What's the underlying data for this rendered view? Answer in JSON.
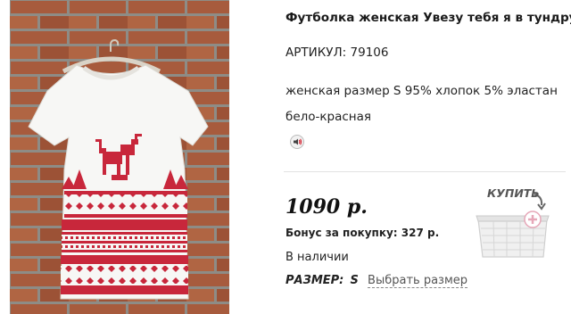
{
  "product": {
    "title": "Футболка женская Увезу тебя я в тундру!",
    "sku_label": "АРТИКУЛ:",
    "sku_value": "79106",
    "description": "женская размер S 95% хлопок 5% эластан",
    "color": "бело-красная",
    "sound_icon": "speaker-icon"
  },
  "purchase": {
    "price": "1090 р.",
    "bonus_label": "Бонус за покупку:",
    "bonus_value": "327 р.",
    "availability": "В наличии",
    "size_label": "РАЗМЕР:",
    "size_value": "S",
    "size_link": "Выбрать размер",
    "buy_label": "КУПИТЬ",
    "buy_icon": "basket-icon"
  },
  "colors": {
    "brick": "#a65a3c",
    "mortar": "#8e8c86",
    "pattern_red": "#c8273b",
    "shirt": "#f7f7f5",
    "plus_badge": "#e6a7b8"
  }
}
